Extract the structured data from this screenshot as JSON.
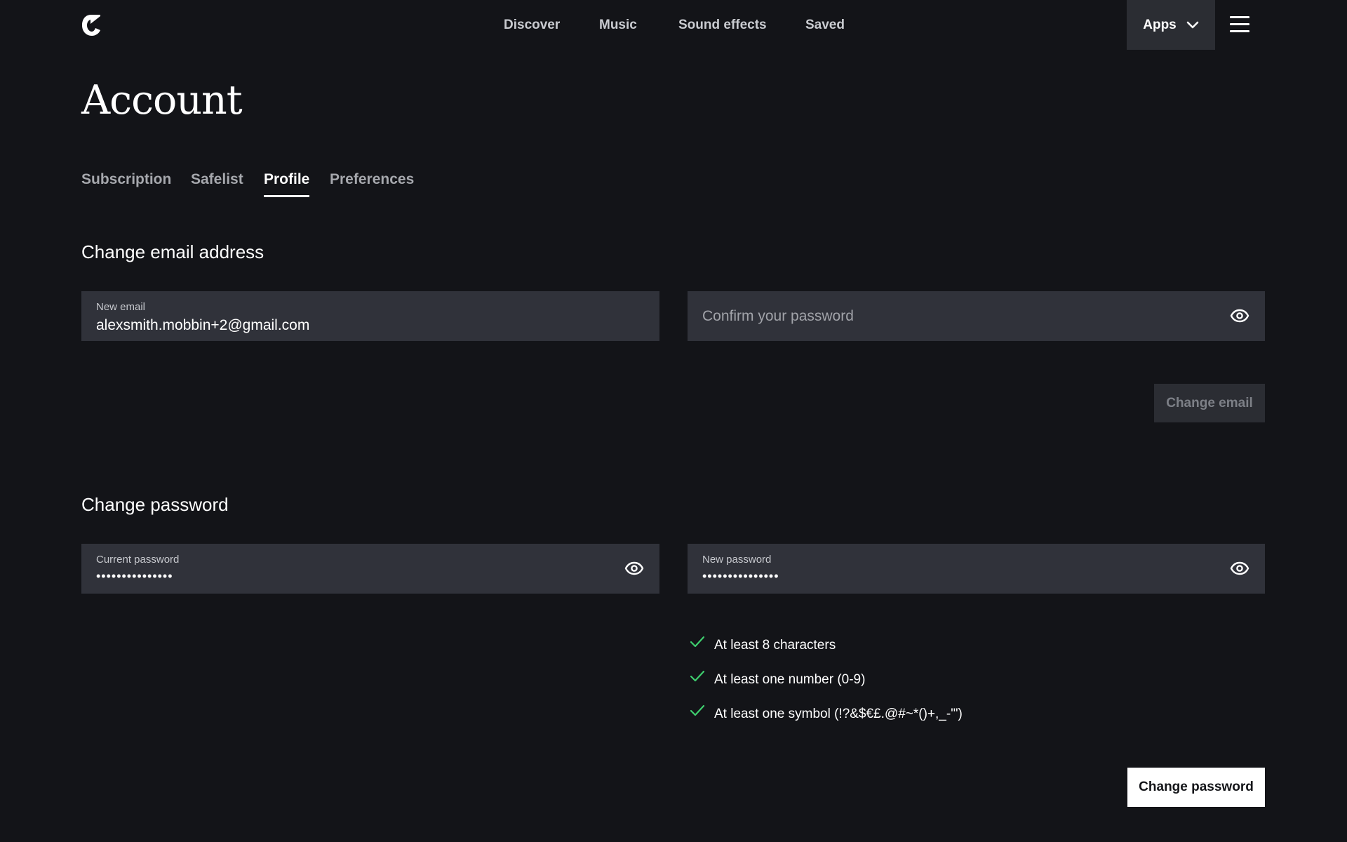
{
  "nav": {
    "links": [
      "Discover",
      "Music",
      "Sound effects",
      "Saved"
    ],
    "apps_label": "Apps",
    "logo_icon": "brand-logo-icon",
    "menu_icon": "hamburger-menu-icon"
  },
  "page": {
    "title": "Account"
  },
  "tabs": [
    {
      "label": "Subscription",
      "active": false
    },
    {
      "label": "Safelist",
      "active": false
    },
    {
      "label": "Profile",
      "active": true
    },
    {
      "label": "Preferences",
      "active": false
    }
  ],
  "email_section": {
    "heading": "Change email address",
    "new_email_label": "New email",
    "new_email_value": "alexsmith.mobbin+2@gmail.com",
    "confirm_password_placeholder": "Confirm your password",
    "submit_label": "Change email"
  },
  "password_section": {
    "heading": "Change password",
    "current_label": "Current password",
    "current_value": "•••••••••••••••",
    "new_label": "New password",
    "new_value": "•••••••••••••••",
    "requirements": [
      "At least 8 characters",
      "At least one number (0-9)",
      "At least one symbol (!?&$€£.@#~*()+,_-'\")"
    ],
    "submit_label": "Change password"
  },
  "colors": {
    "background": "#131418",
    "field": "#30323a",
    "check": "#3ecf6e",
    "primary_button": "#ffffff"
  }
}
